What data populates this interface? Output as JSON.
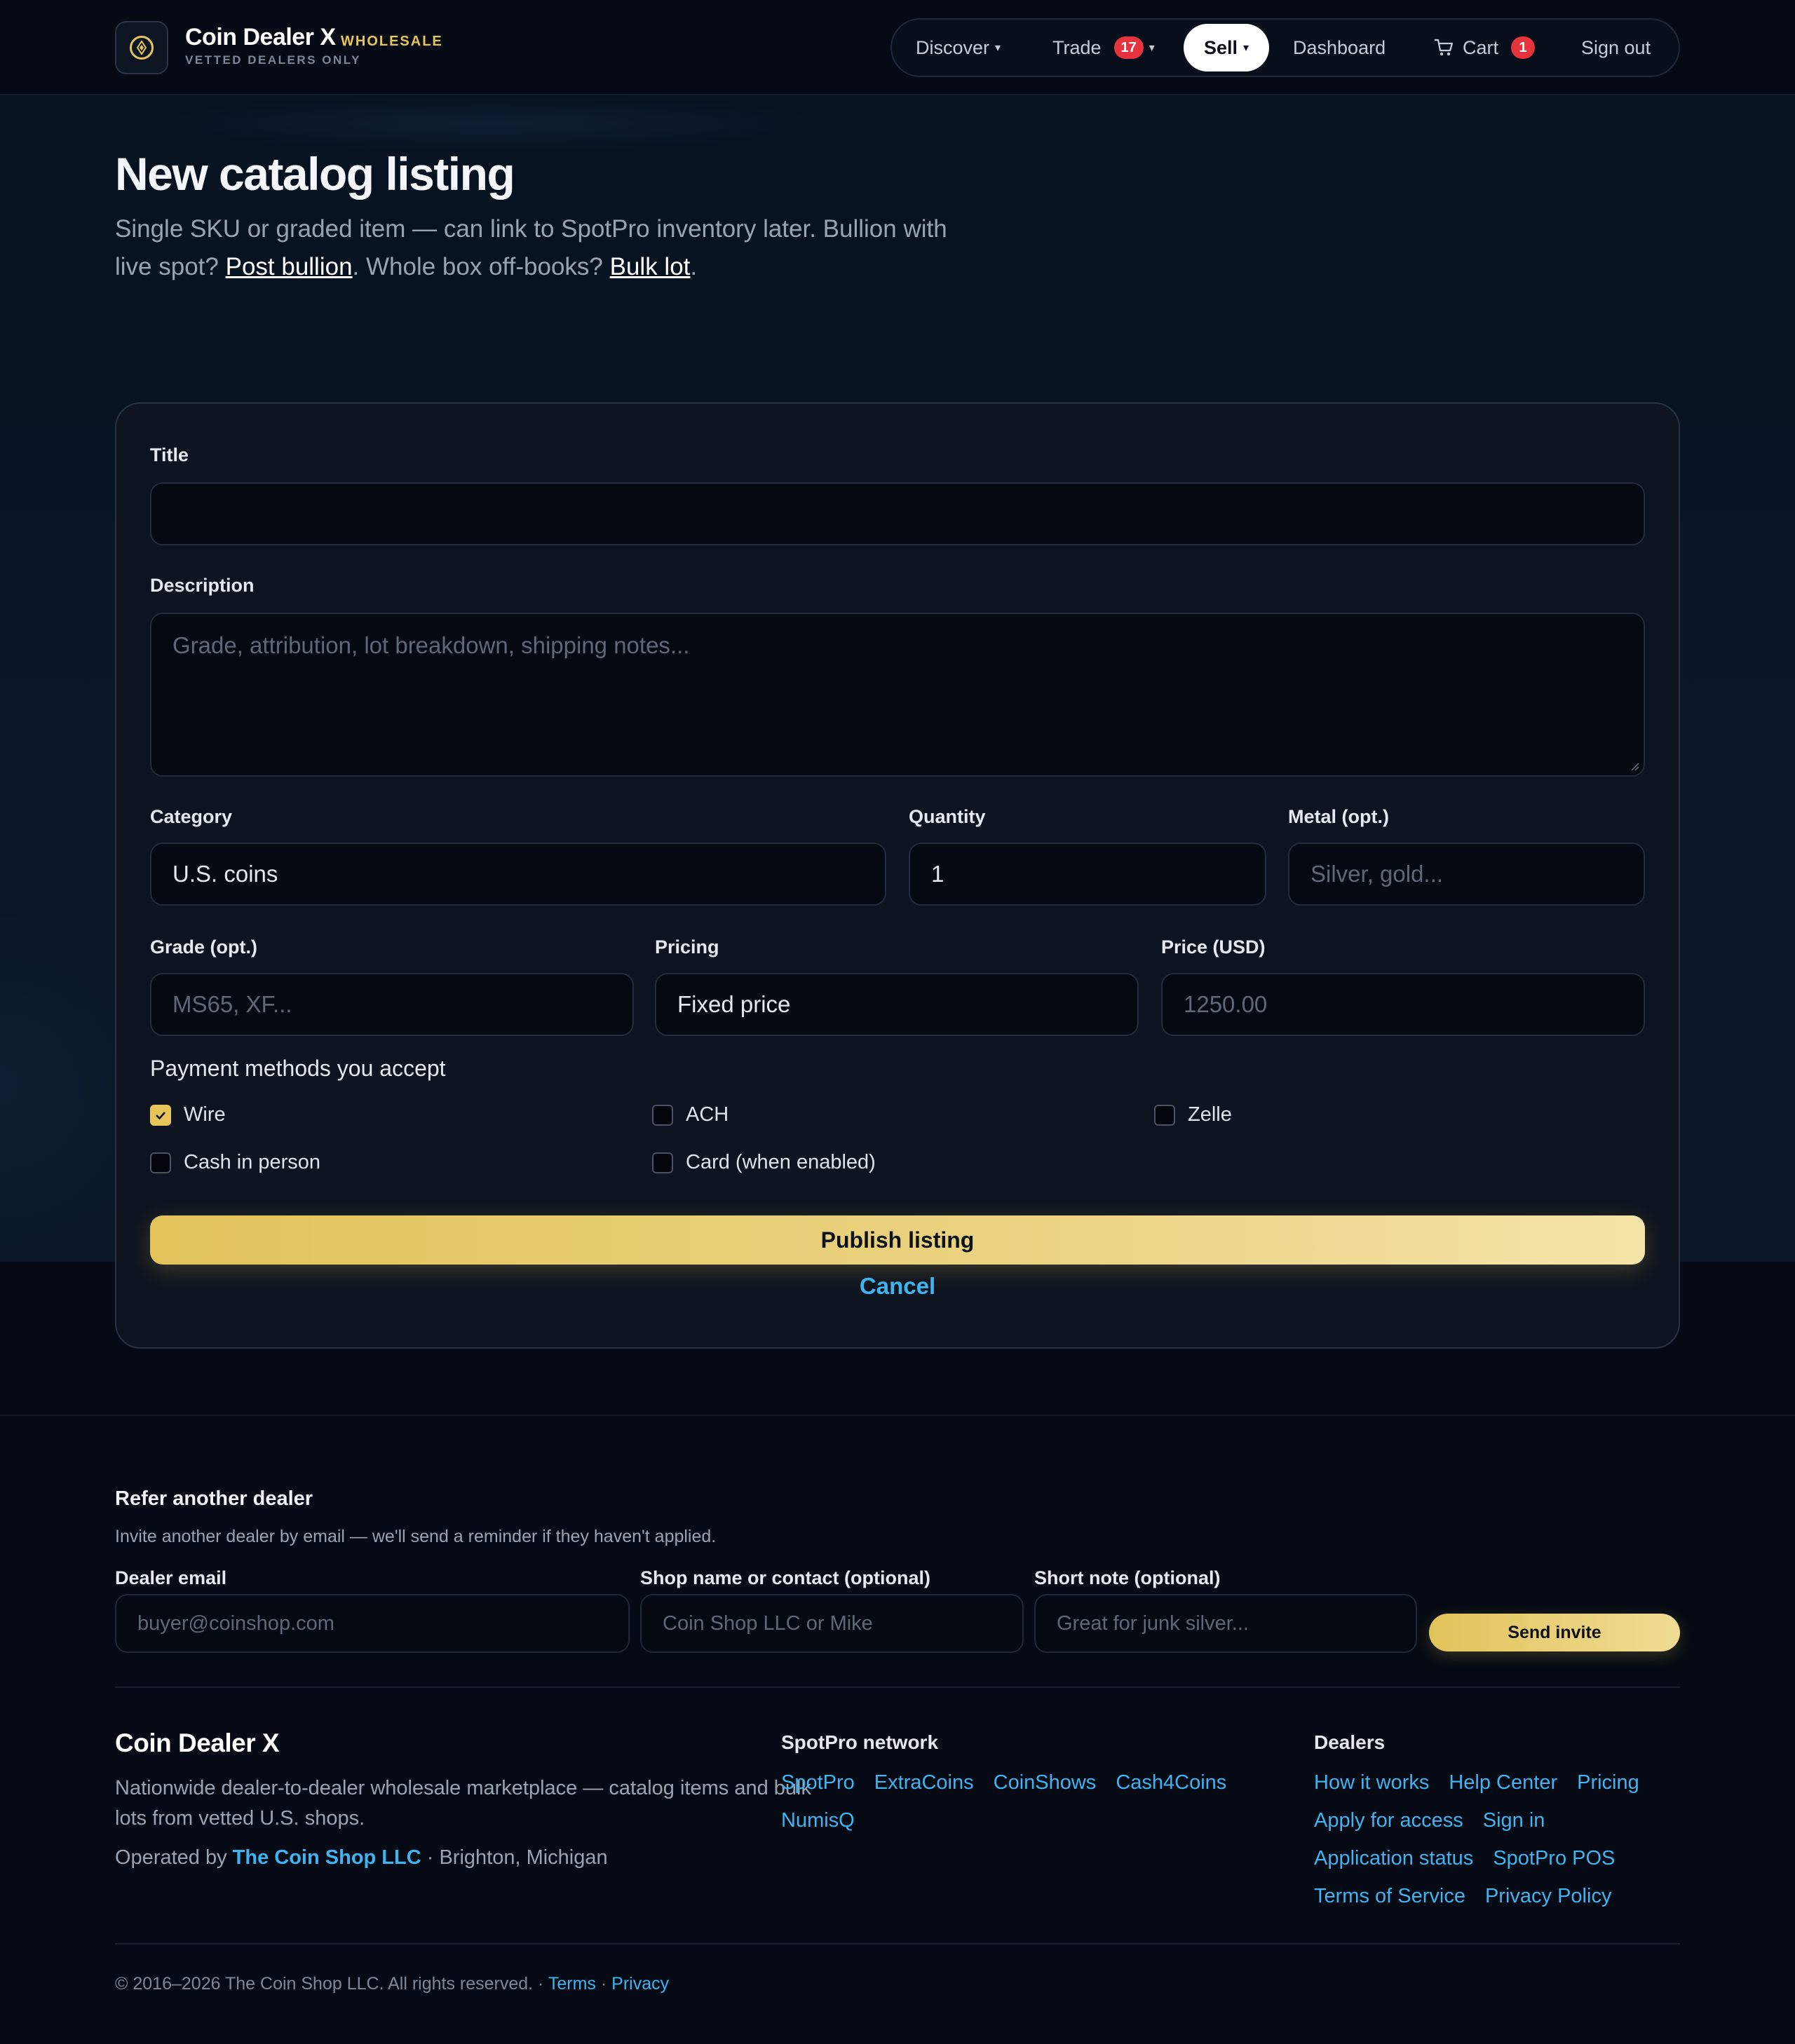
{
  "brand": {
    "name": "Coin Dealer X",
    "tag": "WHOLESALE",
    "subtitle": "VETTED DEALERS ONLY"
  },
  "nav": {
    "discover": "Discover",
    "trade": "Trade",
    "trade_badge": "17",
    "sell": "Sell",
    "dashboard": "Dashboard",
    "cart": "Cart",
    "cart_badge": "1",
    "signout": "Sign out"
  },
  "page": {
    "title": "New catalog listing",
    "intro_1": "Single SKU or graded item — can link to SpotPro inventory later. Bullion with live spot? ",
    "intro_link_1": "Post bullion",
    "intro_2": ". Whole box off-books? ",
    "intro_link_2": "Bulk lot",
    "intro_3": "."
  },
  "form": {
    "title_label": "Title",
    "title_value": "",
    "description_label": "Description",
    "description_placeholder": "Grade, attribution, lot breakdown, shipping notes...",
    "category_label": "Category",
    "category_value": "U.S. coins",
    "quantity_label": "Quantity",
    "quantity_value": "1",
    "metal_label": "Metal (opt.)",
    "metal_placeholder": "Silver, gold...",
    "grade_label": "Grade (opt.)",
    "grade_placeholder": "MS65, XF...",
    "pricing_label": "Pricing",
    "pricing_value": "Fixed price",
    "price_label": "Price (USD)",
    "price_placeholder": "1250.00",
    "payment_title": "Payment methods you accept",
    "payments": [
      {
        "label": "Wire",
        "checked": true
      },
      {
        "label": "ACH",
        "checked": false
      },
      {
        "label": "Zelle",
        "checked": false
      },
      {
        "label": "Cash in person",
        "checked": false
      },
      {
        "label": "Card (when enabled)",
        "checked": false
      }
    ],
    "publish": "Publish listing",
    "cancel": "Cancel"
  },
  "refer": {
    "title": "Refer another dealer",
    "subtitle": "Invite another dealer by email — we'll send a reminder if they haven't applied.",
    "email_label": "Dealer email",
    "email_placeholder": "buyer@coinshop.com",
    "shop_label": "Shop name or contact (optional)",
    "shop_placeholder": "Coin Shop LLC or Mike",
    "note_label": "Short note (optional)",
    "note_placeholder": "Great for junk silver...",
    "send": "Send invite"
  },
  "footer": {
    "brand": "Coin Dealer X",
    "description": "Nationwide dealer-to-dealer wholesale marketplace — catalog items and bulk lots from vetted U.S. shops.",
    "operated_prefix": "Operated by ",
    "operated_company": "The Coin Shop LLC",
    "operated_suffix": " · Brighton, Michigan",
    "network_title": "SpotPro network",
    "network_links": [
      "SpotPro",
      "ExtraCoins",
      "CoinShows",
      "Cash4Coins",
      "NumisQ"
    ],
    "dealers_title": "Dealers",
    "dealers_links": [
      "How it works",
      "Help Center",
      "Pricing",
      "Apply for access",
      "Sign in",
      "Application status",
      "SpotPro POS",
      "Terms of Service",
      "Privacy Policy"
    ],
    "copyright": "© 2016–2026 The Coin Shop LLC. All rights reserved. · ",
    "terms": "Terms",
    "privacy": "Privacy"
  },
  "colors": {
    "accent_gold": "#e8c55a",
    "link_blue": "#3eb4f0",
    "badge_red": "#e5343d"
  }
}
